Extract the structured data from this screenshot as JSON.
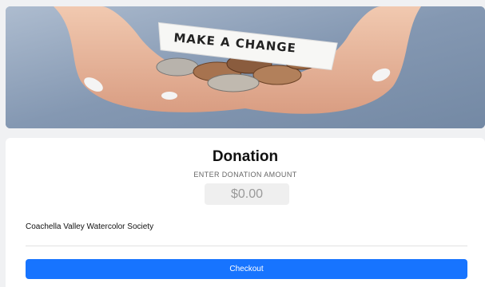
{
  "hero": {
    "note_text": "MAKE A CHANGE"
  },
  "donation": {
    "title": "Donation",
    "amount_label": "ENTER DONATION AMOUNT",
    "amount_value": "$0.00",
    "organization": "Coachella Valley Watercolor Society",
    "checkout_label": "Checkout"
  },
  "colors": {
    "accent": "#1774ff",
    "background": "#f0f1f3"
  }
}
